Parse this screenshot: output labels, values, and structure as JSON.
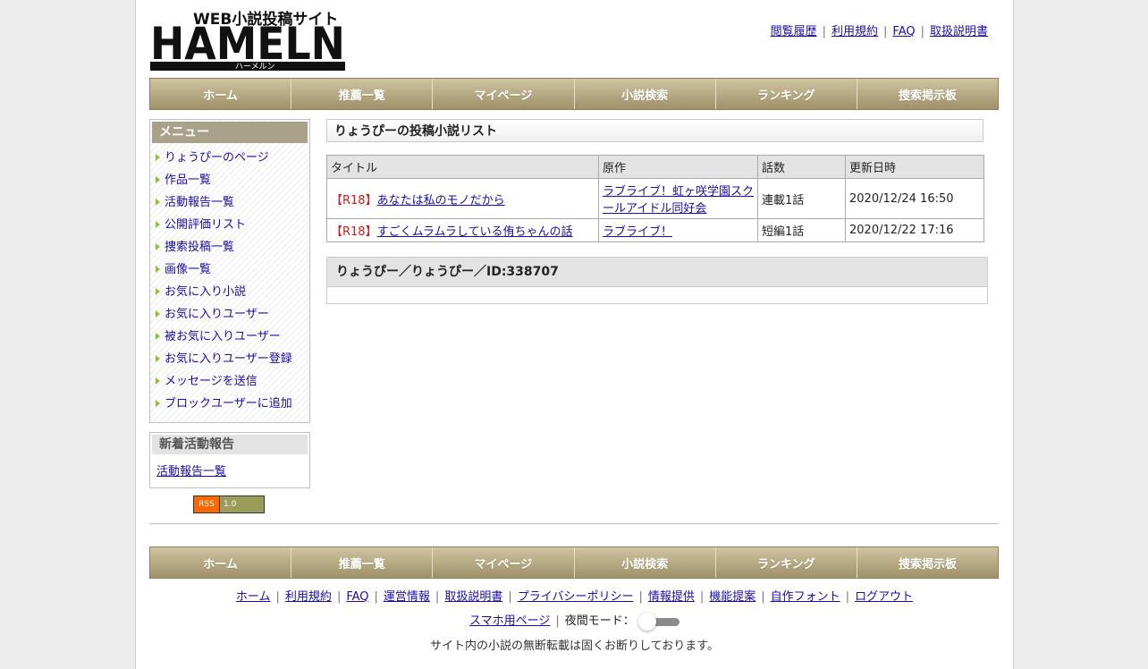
{
  "header": {
    "logo_main": "HAMELN",
    "logo_sub": "WEB小説投稿サイト",
    "logo_kana": "ハーメルン",
    "links": [
      "閲覧履歴",
      "利用規約",
      "FAQ",
      "取扱説明書"
    ]
  },
  "nav": [
    "ホーム",
    "推薦一覧",
    "マイページ",
    "小説検索",
    "ランキング",
    "捜索掲示板"
  ],
  "sidebar": {
    "menu_title": "メニュー",
    "menu_items": [
      "りょうぴーのページ",
      "作品一覧",
      "活動報告一覧",
      "公開評価リスト",
      "捜索投稿一覧",
      "画像一覧",
      "お気に入り小説",
      "お気に入りユーザー",
      "被お気に入りユーザー",
      "お気に入りユーザー登録",
      "メッセージを送信",
      "ブロックユーザーに追加"
    ],
    "news_title": "新着活動報告",
    "news_link": "活動報告一覧",
    "rss_left": "RSS",
    "rss_right": "1.0"
  },
  "main": {
    "title": "りょうぴーの投稿小説リスト",
    "table_headers": [
      "タイトル",
      "原作",
      "話数",
      "更新日時"
    ],
    "rows": [
      {
        "tag": "【R18】",
        "title": "あなたは私のモノだから",
        "origin": "ラブライブ！虹ヶ咲学園スクールアイドル同好会",
        "episodes": "連載1話",
        "updated": "2020/12/24 16:50"
      },
      {
        "tag": "【R18】",
        "title": "すごくムラムラしている侑ちゃんの話",
        "origin": "ラブライブ！",
        "episodes": "短編1話",
        "updated": "2020/12/22 17:16"
      }
    ],
    "profile_title": "りょうぴー／りょうぴー／ID:338707"
  },
  "footer": {
    "links": [
      "ホーム",
      "利用規約",
      "FAQ",
      "運営情報",
      "取扱説明書",
      "プライバシーポリシー",
      "情報提供",
      "機能提案",
      "自作フォント",
      "ログアウト"
    ],
    "mobile_link": "スマホ用ページ",
    "night_mode_label": "夜間モード：",
    "notice": "サイト内の小説の無断転載は固くお断りしております。"
  },
  "colors": {
    "nav_gold": "#b0a47c",
    "menu_head": "#a9a189",
    "r18_red": "#d21a1a",
    "link_blue": "#1a0dab"
  }
}
